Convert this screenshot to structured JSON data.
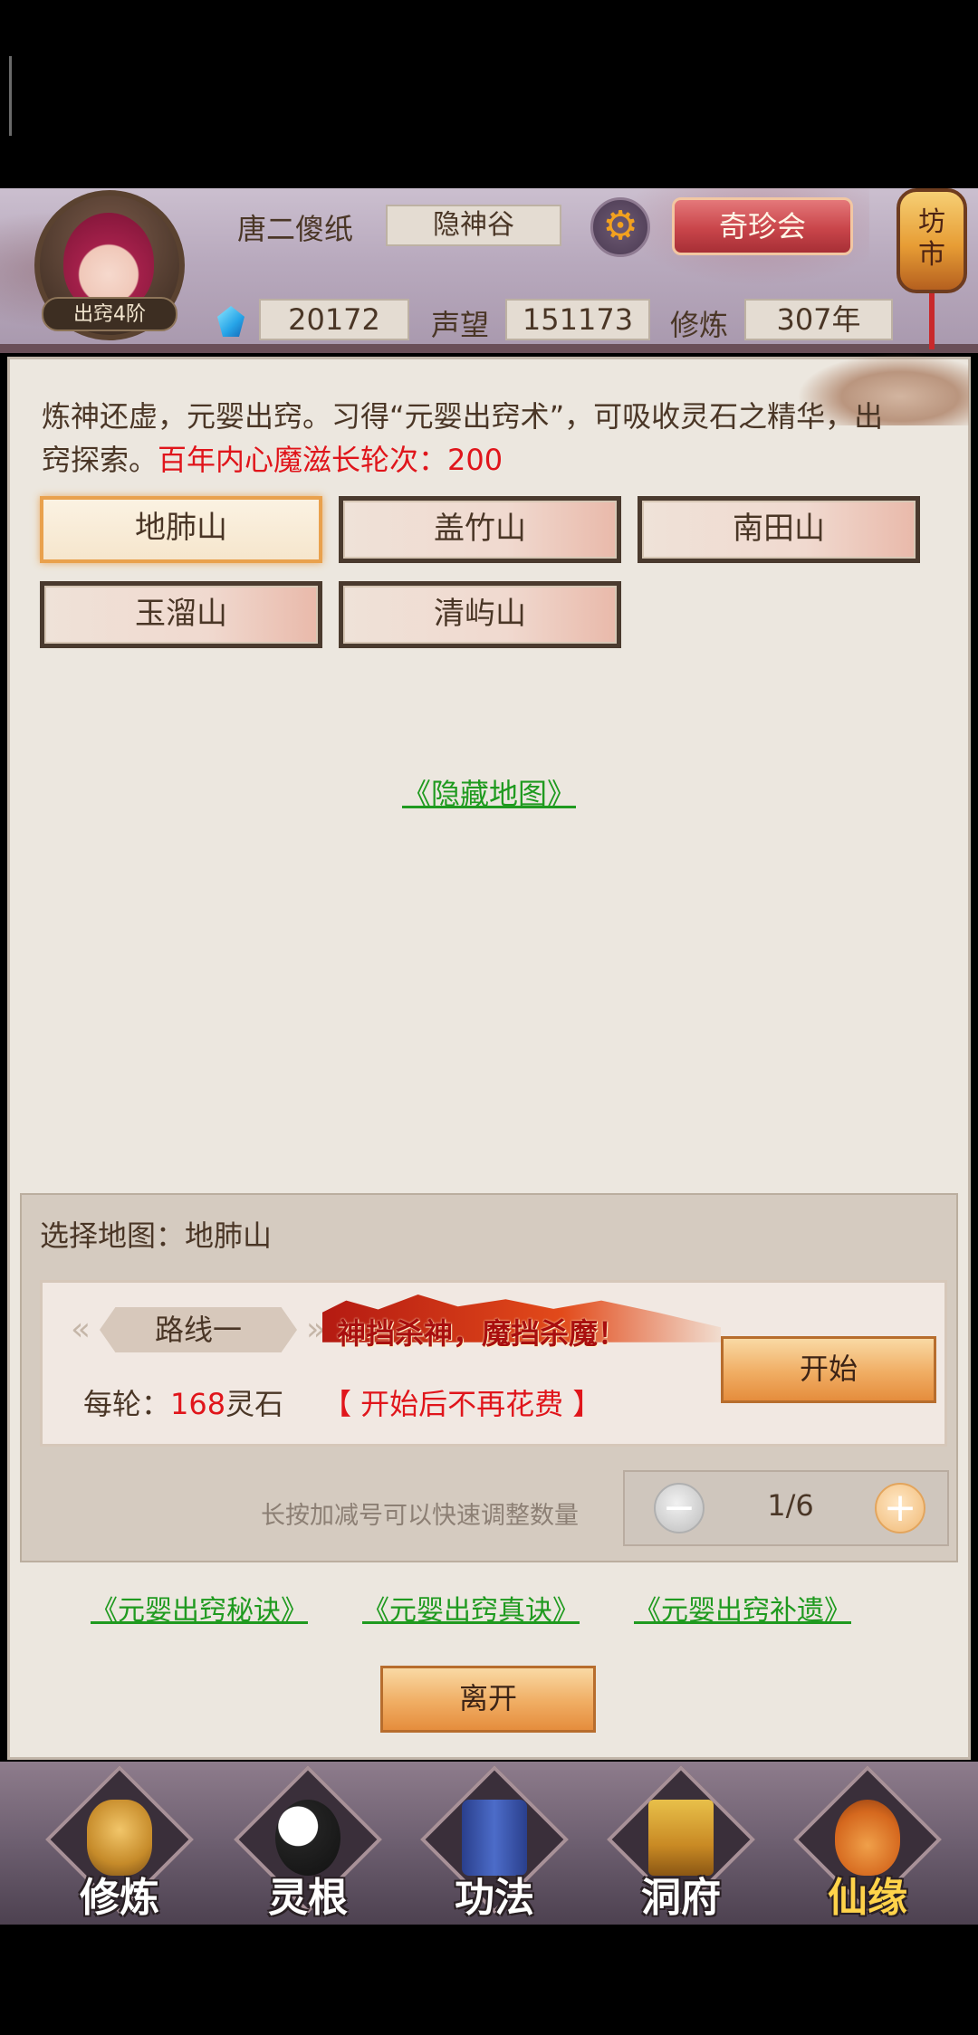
{
  "header": {
    "player_name": "唐二傻纸",
    "sect": "隐神谷",
    "realm_badge": "出窍4阶",
    "treasure_button": "奇珍会",
    "market_lantern": "坊市",
    "spirit_stones": "20172",
    "prestige_label": "声望",
    "prestige_value": "151173",
    "cultivation_label": "修炼",
    "cultivation_value": "307年"
  },
  "main": {
    "description": "炼神还虚，元婴出窍。习得“元婴出窍术”，可吸收灵石之精华，出窍探索。",
    "description_highlight": "百年内心魔滋长轮次：200",
    "maps": [
      {
        "label": "地肺山",
        "selected": true
      },
      {
        "label": "盖竹山",
        "selected": false
      },
      {
        "label": "南田山",
        "selected": false
      },
      {
        "label": "玉溜山",
        "selected": false
      },
      {
        "label": "清屿山",
        "selected": false
      }
    ],
    "hidden_map_link": "《隐藏地图》"
  },
  "selection": {
    "selected_map_label": "选择地图：地肺山",
    "route_name": "路线一",
    "slogan": "神挡杀神，魔挡杀魔！",
    "cost_prefix": "每轮：",
    "cost_value": "168",
    "cost_unit": "灵石",
    "no_more_cost": "【 开始后不再花费 】",
    "start_button": "开始",
    "hint": "长按加减号可以快速调整数量",
    "count": "1/6"
  },
  "links": {
    "secret": "《元婴出窍秘诀》",
    "true_art": "《元婴出窍真诀》",
    "supplement": "《元婴出窍补遗》"
  },
  "leave_button": "离开",
  "nav": {
    "items": [
      {
        "label": "修炼",
        "icon": "hooded-cultivator-icon"
      },
      {
        "label": "灵根",
        "icon": "yin-yang-sword-icon"
      },
      {
        "label": "功法",
        "icon": "scroll-book-icon"
      },
      {
        "label": "洞府",
        "icon": "pagoda-icon"
      },
      {
        "label": "仙缘",
        "icon": "gourd-icon"
      }
    ]
  },
  "colors": {
    "highlight_red": "#e0151b",
    "link_green": "#1f9a1f",
    "button_orange": "#f0ad63",
    "treasure_red": "#c9454a"
  }
}
